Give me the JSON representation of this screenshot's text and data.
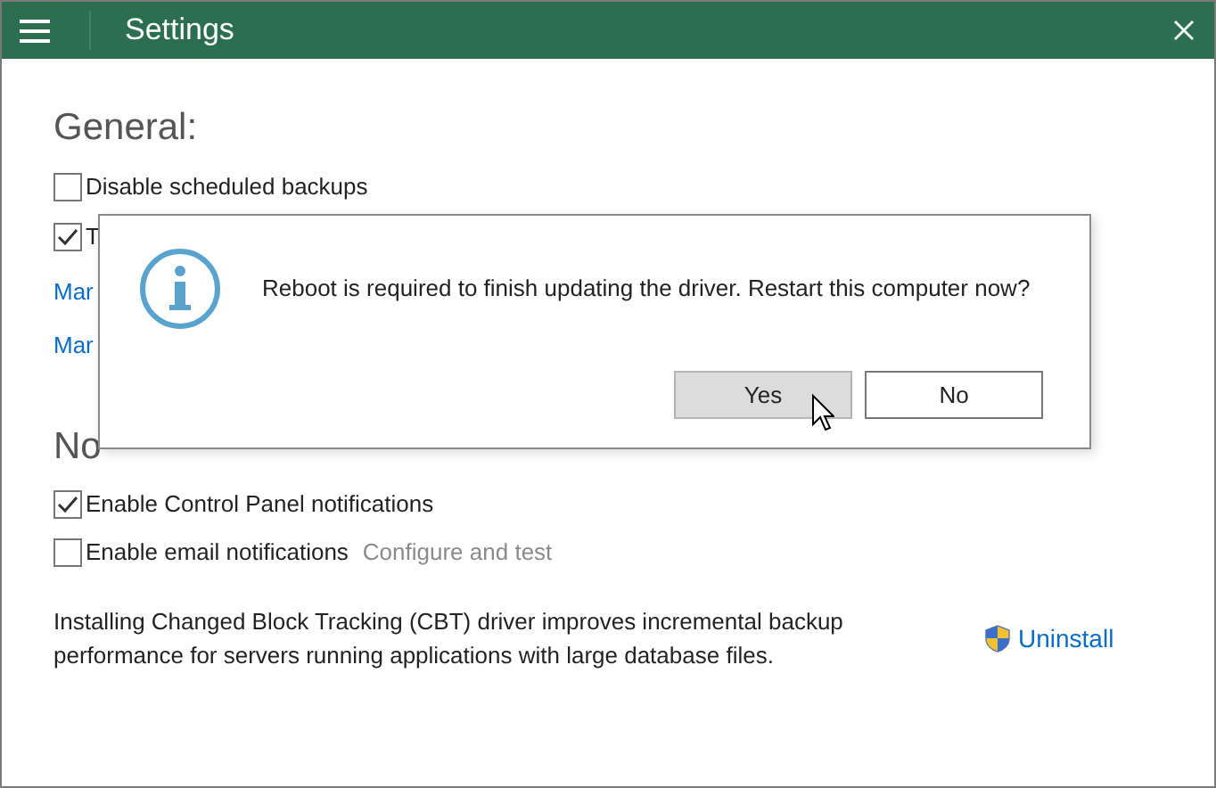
{
  "window": {
    "title": "Settings"
  },
  "general": {
    "heading": "General:",
    "options": [
      {
        "label": "Disable scheduled backups",
        "checked": false
      },
      {
        "label": "T",
        "checked": true
      }
    ],
    "links": [
      "Mar",
      "Mar"
    ]
  },
  "notifications": {
    "heading": "No",
    "options": [
      {
        "label": "Enable Control Panel notifications",
        "checked": true
      },
      {
        "label": "Enable email notifications",
        "checked": false,
        "link": "Configure and test"
      }
    ]
  },
  "cbt": {
    "text": "Installing Changed Block Tracking (CBT) driver improves incremental backup performance for servers running applications with large database files.",
    "action": "Uninstall"
  },
  "dialog": {
    "message": "Reboot is required to finish updating the driver. Restart this computer now?",
    "buttons": [
      {
        "label": "Yes",
        "selected": true
      },
      {
        "label": "No",
        "selected": false
      }
    ]
  }
}
